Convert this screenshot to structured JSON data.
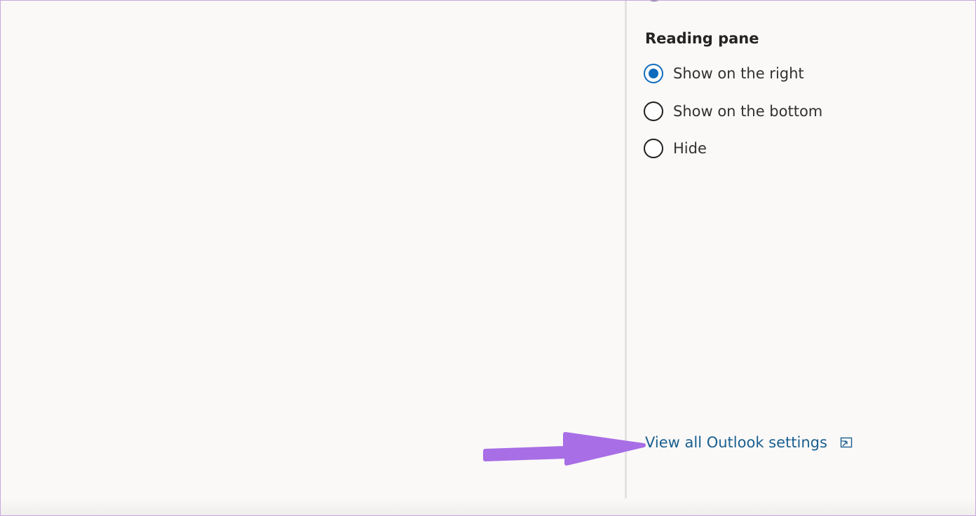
{
  "reading_pane": {
    "title": "Reading pane",
    "options": [
      {
        "label": "Show on the right",
        "selected": true
      },
      {
        "label": "Show on the bottom",
        "selected": false
      },
      {
        "label": "Hide",
        "selected": false
      }
    ]
  },
  "footer": {
    "link_label": "View all Outlook settings",
    "link_icon": "open-in-new-window-icon"
  },
  "colors": {
    "accent": "#0f6cbd",
    "link": "#1a5f8f",
    "annotation": "#a86ee6"
  }
}
